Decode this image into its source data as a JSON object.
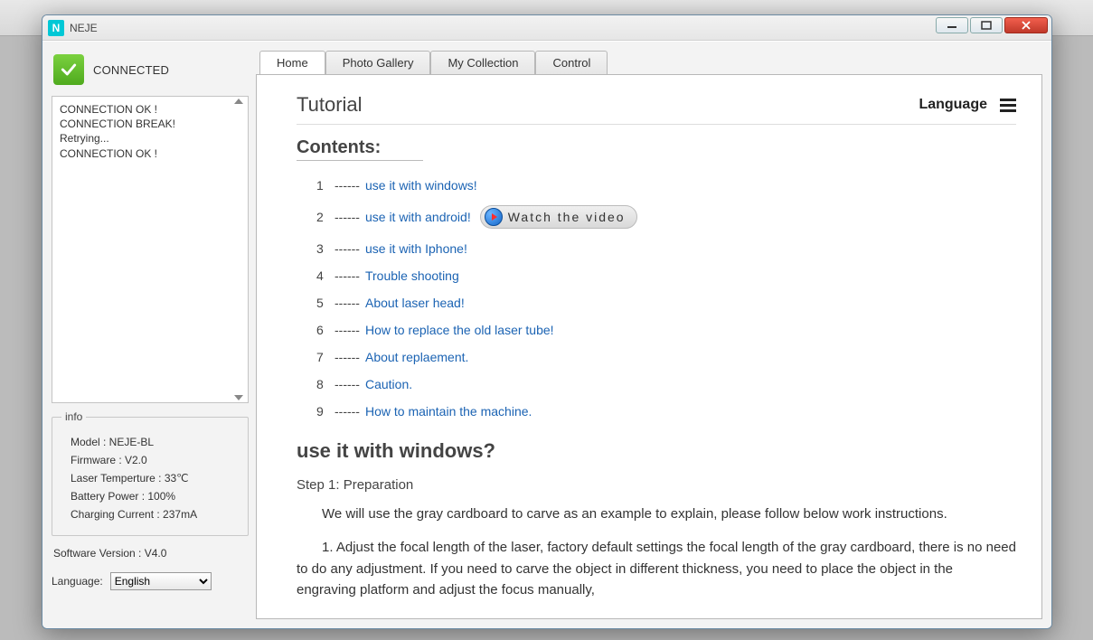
{
  "app": {
    "icon_letter": "N",
    "title": "NEJE"
  },
  "sidebar": {
    "connected_label": "CONNECTED",
    "log": {
      "l0": "CONNECTION OK !",
      "l1": "CONNECTION BREAK!",
      "l2": "Retrying...",
      "l3": "CONNECTION OK !"
    },
    "info": {
      "legend": "info",
      "model": "Model : NEJE-BL",
      "firmware": "Firmware : V2.0",
      "laser_temp": "Laser Temperture : 33℃",
      "battery": "Battery Power : 100%",
      "charging": "Charging Current : 237mA"
    },
    "software_version": "Software Version : V4.0",
    "lang_label": "Language:",
    "lang_value": "English"
  },
  "tabs": {
    "home": "Home",
    "gallery": "Photo Gallery",
    "collection": "My Collection",
    "control": "Control"
  },
  "content": {
    "tutorial_title": "Tutorial",
    "language_label": "Language",
    "contents_label": "Contents:",
    "toc": {
      "dash": " ------ ",
      "n1": "1",
      "t1": "use it with windows!",
      "n2": "2",
      "t2": "use it with android!",
      "n3": "3",
      "t3": "use it with Iphone!",
      "n4": "4",
      "t4": "Trouble shooting",
      "n5": "5",
      "t5": "About laser head!",
      "n6": "6",
      "t6": "How to replace the old laser tube!",
      "n7": "7",
      "t7": "About replaement.",
      "n8": "8",
      "t8": "Caution.",
      "n9": "9",
      "t9": "How to maintain the machine."
    },
    "watch_video": "Watch the video",
    "section1_title": "use it with windows?",
    "step1_title": "Step 1: Preparation",
    "para1": "We will use the gray cardboard to carve as an example to explain, please follow below work instructions.",
    "para2": "1. Adjust the focal length of the laser, factory default settings the focal length of the gray cardboard, there is no need to do any adjustment. If you need to carve the object in different thickness, you need to place the object in the engraving platform and adjust the focus manually,"
  }
}
